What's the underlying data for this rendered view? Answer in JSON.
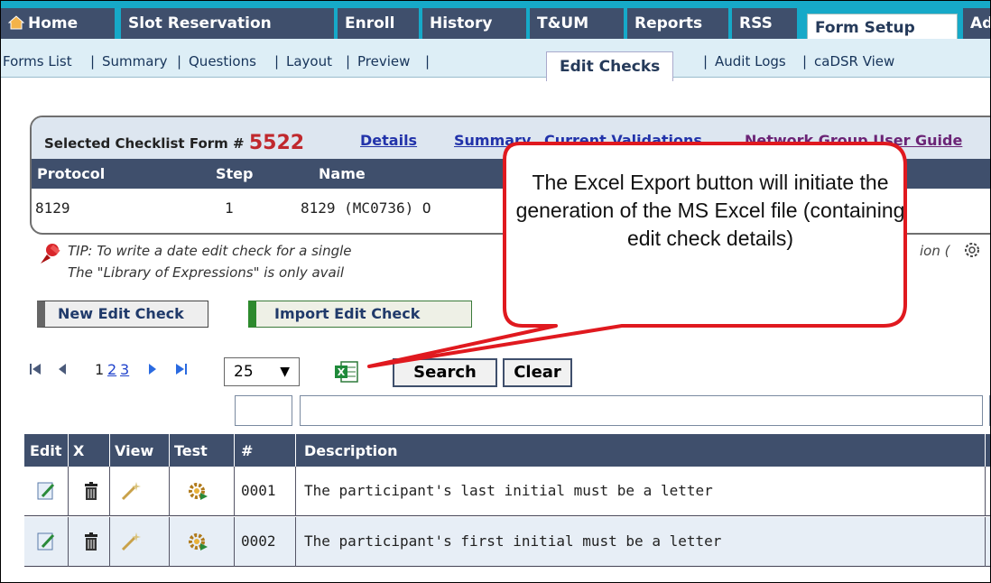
{
  "nav": {
    "tabs": [
      "Home",
      "Slot Reservation",
      "Enroll",
      "History",
      "T&UM",
      "Reports",
      "RSS",
      "Form Setup",
      "Ad"
    ],
    "subtabs": [
      "Forms List",
      "Summary",
      "Questions",
      "Layout",
      "Preview",
      "Edit Checks",
      "Audit Logs",
      "caDSR View"
    ]
  },
  "form": {
    "selected_label": "Selected Checklist Form #",
    "form_number": "5522",
    "links": [
      "Details",
      "Summary",
      "Current Validations",
      "Network Group User Guide"
    ],
    "columns": [
      "Protocol",
      "Step",
      "Name"
    ],
    "row": [
      "8129",
      "1",
      "8129 (MC0736) O"
    ]
  },
  "tip": {
    "line1": "TIP: To write a date edit check for a single",
    "line2": "The \"Library of Expressions\" is only avail",
    "line1_end": "ion ("
  },
  "buttons": {
    "new_edit_check": "New Edit Check",
    "import_edit_check": "Import Edit Check"
  },
  "pager": {
    "current": "1",
    "pages": [
      "2",
      "3"
    ],
    "page_size": "25"
  },
  "actions": {
    "search": "Search",
    "clear": "Clear"
  },
  "table": {
    "headers": [
      "Edit",
      "X",
      "View",
      "Test",
      "#",
      "Description"
    ],
    "rows": [
      {
        "num": "0001",
        "description": "The participant's last initial must be a letter"
      },
      {
        "num": "0002",
        "description": "The participant's first initial must be a letter"
      }
    ]
  },
  "callout": {
    "text": "The Excel Export button will initiate the generation of the MS Excel file (containing edit check details)"
  }
}
